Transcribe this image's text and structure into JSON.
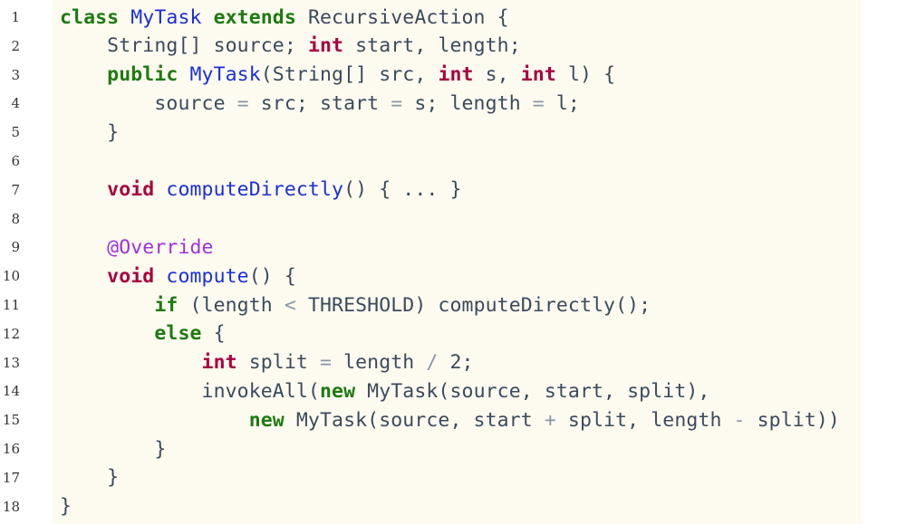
{
  "lines": [
    {
      "n": "1",
      "tokens": [
        [
          "kw",
          "class "
        ],
        [
          "fn",
          "MyTask "
        ],
        [
          "kw",
          "extends "
        ],
        [
          "pl",
          "RecursiveAction {"
        ]
      ]
    },
    {
      "n": "2",
      "tokens": [
        [
          "pl",
          "    String[] source; "
        ],
        [
          "ty",
          "int"
        ],
        [
          "pl",
          " start, length;"
        ]
      ]
    },
    {
      "n": "3",
      "tokens": [
        [
          "kw",
          "    public "
        ],
        [
          "fn",
          "MyTask"
        ],
        [
          "pl",
          "(String[] src, "
        ],
        [
          "ty",
          "int"
        ],
        [
          "pl",
          " s, "
        ],
        [
          "ty",
          "int"
        ],
        [
          "pl",
          " l) {"
        ]
      ]
    },
    {
      "n": "4",
      "tokens": [
        [
          "pl",
          "        source "
        ],
        [
          "op",
          "="
        ],
        [
          "pl",
          " src; start "
        ],
        [
          "op",
          "="
        ],
        [
          "pl",
          " s; length "
        ],
        [
          "op",
          "="
        ],
        [
          "pl",
          " l;"
        ]
      ]
    },
    {
      "n": "5",
      "tokens": [
        [
          "pl",
          "    }"
        ]
      ]
    },
    {
      "n": "6",
      "tokens": []
    },
    {
      "n": "7",
      "tokens": [
        [
          "ty",
          "    void "
        ],
        [
          "fn",
          "computeDirectly"
        ],
        [
          "pl",
          "() { ... }"
        ]
      ]
    },
    {
      "n": "8",
      "tokens": []
    },
    {
      "n": "9",
      "tokens": [
        [
          "an",
          "    @Override"
        ]
      ]
    },
    {
      "n": "10",
      "tokens": [
        [
          "ty",
          "    void "
        ],
        [
          "fn",
          "compute"
        ],
        [
          "pl",
          "() {"
        ]
      ]
    },
    {
      "n": "11",
      "tokens": [
        [
          "kw",
          "        if "
        ],
        [
          "pl",
          "(length "
        ],
        [
          "op",
          "<"
        ],
        [
          "pl",
          " THRESHOLD) computeDirectly();"
        ]
      ]
    },
    {
      "n": "12",
      "tokens": [
        [
          "kw",
          "        else "
        ],
        [
          "pl",
          "{"
        ]
      ]
    },
    {
      "n": "13",
      "tokens": [
        [
          "ty",
          "            int"
        ],
        [
          "pl",
          " split "
        ],
        [
          "op",
          "="
        ],
        [
          "pl",
          " length "
        ],
        [
          "op",
          "/"
        ],
        [
          "pl",
          " 2;"
        ]
      ]
    },
    {
      "n": "14",
      "tokens": [
        [
          "pl",
          "            invokeAll("
        ],
        [
          "kw",
          "new "
        ],
        [
          "pl",
          "MyTask(source, start, split),"
        ]
      ]
    },
    {
      "n": "15",
      "tokens": [
        [
          "kw",
          "                new "
        ],
        [
          "pl",
          "MyTask(source, start "
        ],
        [
          "op",
          "+"
        ],
        [
          "pl",
          " split, length "
        ],
        [
          "op",
          "-"
        ],
        [
          "pl",
          " split))"
        ]
      ]
    },
    {
      "n": "16",
      "tokens": [
        [
          "pl",
          "        }"
        ]
      ]
    },
    {
      "n": "17",
      "tokens": [
        [
          "pl",
          "    }"
        ]
      ]
    },
    {
      "n": "18",
      "tokens": [
        [
          "pl",
          "}"
        ]
      ]
    }
  ]
}
